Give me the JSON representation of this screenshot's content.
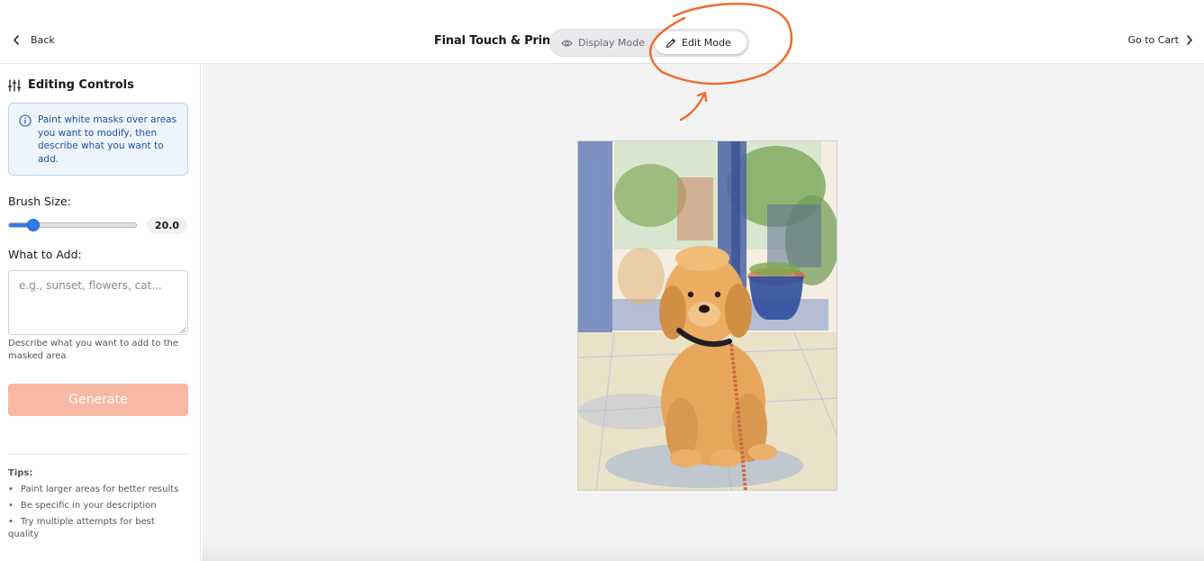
{
  "header": {
    "back_label": "Back",
    "title": "Final Touch & Print",
    "modes": {
      "display_label": "Display Mode",
      "edit_label": "Edit Mode",
      "active": "edit"
    },
    "cart_label": "Go to Cart"
  },
  "sidebar": {
    "title": "Editing Controls",
    "info_text": "Paint white masks over areas you want to modify, then describe what you want to add.",
    "brush_label": "Brush Size:",
    "brush_value": "20.0",
    "brush_level_fraction": 0.19,
    "what_label": "What to Add:",
    "prompt_placeholder": "e.g., sunset, flowers, cat...",
    "prompt_hint": "Describe what you want to add to the masked area",
    "generate_label": "Generate",
    "tips_title": "Tips:",
    "tips": [
      "Paint larger areas for better results",
      "Be specific in your description",
      "Try multiple attempts for best quality"
    ]
  },
  "colors": {
    "accent": "#2f7ae5",
    "generate_disabled": "#f7b6a0",
    "info_bg": "#eef5fd",
    "info_text": "#1f4f9c",
    "annotation": "#ee6a2c"
  },
  "icons": {
    "back": "chevron-left-icon",
    "display_mode": "eye-icon",
    "edit_mode": "pencil-icon",
    "cart": "chevron-right-icon",
    "controls": "sliders-icon",
    "info": "info-circle-icon"
  }
}
